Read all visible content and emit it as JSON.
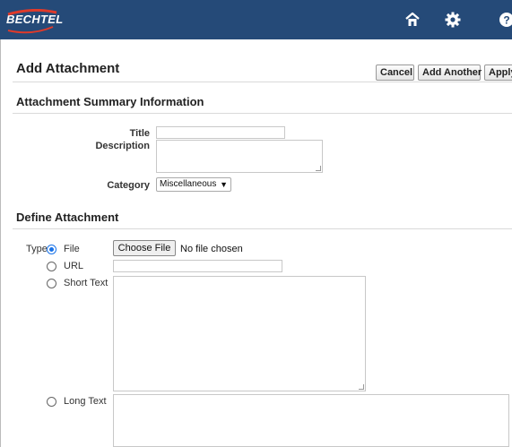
{
  "header": {
    "logo_text": "BECHTEL",
    "icons": [
      "home-icon",
      "gear-icon",
      "help-icon"
    ],
    "background": "#254a78"
  },
  "page": {
    "title": "Add Attachment",
    "buttons": {
      "cancel": "Cancel",
      "add_another": "Add Another",
      "apply": "Apply"
    }
  },
  "summary": {
    "heading": "Attachment Summary Information",
    "title_label": "Title",
    "title_value": "",
    "description_label": "Description",
    "description_value": "",
    "category_label": "Category",
    "category_selected": "Miscellaneous"
  },
  "define": {
    "heading": "Define Attachment",
    "type_label": "Type",
    "options": {
      "file": "File",
      "url": "URL",
      "short_text": "Short Text",
      "long_text": "Long Text"
    },
    "selected": "File",
    "choose_file_label": "Choose File",
    "no_file_text": "No file chosen",
    "url_value": "",
    "short_text_value": "",
    "long_text_value": ""
  },
  "accent": "#1a73e8"
}
